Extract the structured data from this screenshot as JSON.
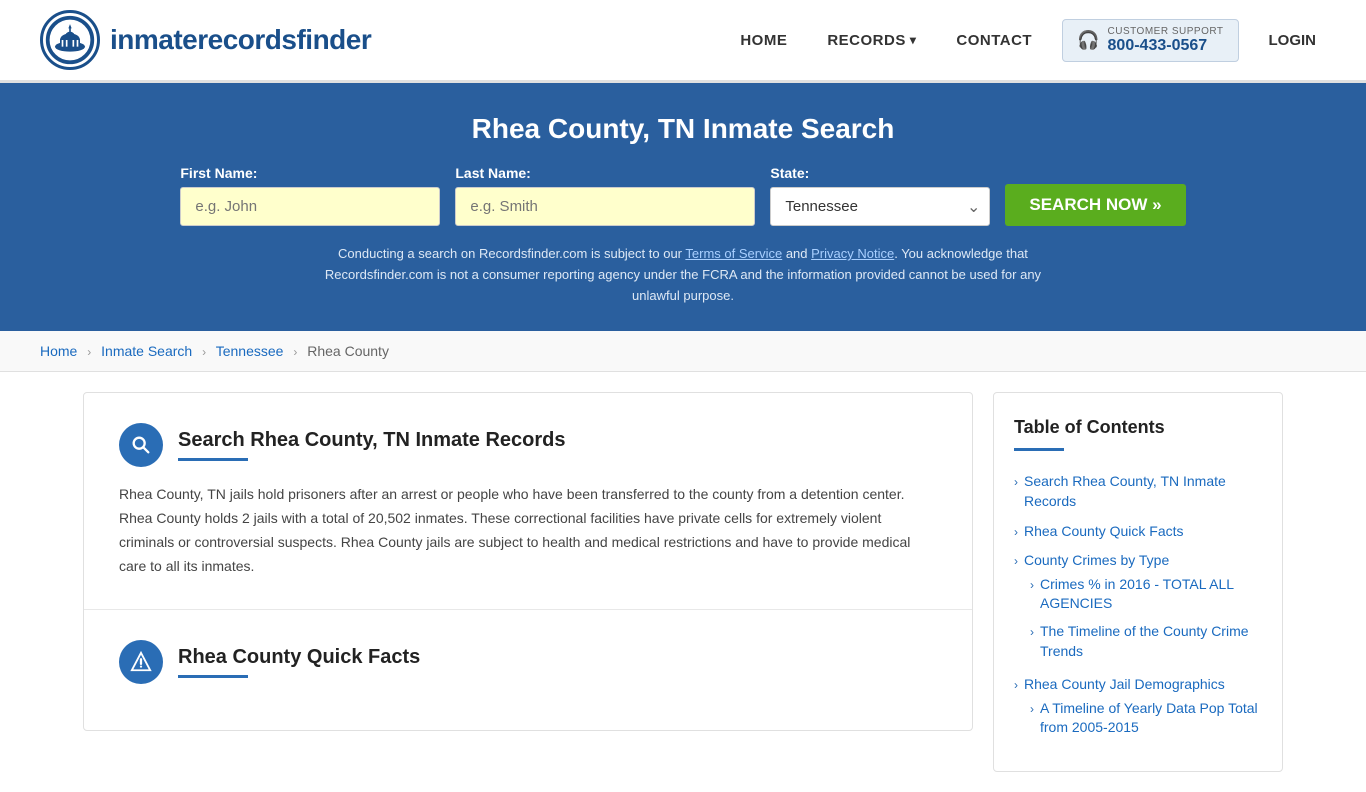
{
  "header": {
    "logo_text_regular": "inmaterecords",
    "logo_text_bold": "finder",
    "nav": {
      "home": "HOME",
      "records": "RECORDS",
      "contact": "CONTACT",
      "login": "LOGIN"
    },
    "support": {
      "label": "CUSTOMER SUPPORT",
      "number": "800-433-0567"
    }
  },
  "search_banner": {
    "title": "Rhea County, TN Inmate Search",
    "first_name_label": "First Name:",
    "first_name_placeholder": "e.g. John",
    "last_name_label": "Last Name:",
    "last_name_placeholder": "e.g. Smith",
    "state_label": "State:",
    "state_value": "Tennessee",
    "search_button": "SEARCH NOW »",
    "disclaimer": "Conducting a search on Recordsfinder.com is subject to our Terms of Service and Privacy Notice. You acknowledge that Recordsfinder.com is not a consumer reporting agency under the FCRA and the information provided cannot be used for any unlawful purpose.",
    "tos_link": "Terms of Service",
    "privacy_link": "Privacy Notice"
  },
  "breadcrumb": {
    "home": "Home",
    "inmate_search": "Inmate Search",
    "state": "Tennessee",
    "county": "Rhea County"
  },
  "main": {
    "section1": {
      "title": "Search Rhea County, TN Inmate Records",
      "body": "Rhea County, TN jails hold prisoners after an arrest or people who have been transferred to the county from a detention center. Rhea County holds 2 jails with a total of 20,502 inmates. These correctional facilities have private cells for extremely violent criminals or controversial suspects. Rhea County jails are subject to health and medical restrictions and have to provide medical care to all its inmates."
    },
    "section2": {
      "title": "Rhea County Quick Facts"
    }
  },
  "toc": {
    "title": "Table of Contents",
    "items": [
      {
        "label": "Search Rhea County, TN Inmate Records",
        "sub": false
      },
      {
        "label": "Rhea County Quick Facts",
        "sub": false
      },
      {
        "label": "County Crimes by Type",
        "sub": false
      },
      {
        "label": "Crimes % in 2016 - TOTAL ALL AGENCIES",
        "sub": true
      },
      {
        "label": "The Timeline of the County Crime Trends",
        "sub": true
      },
      {
        "label": "Rhea County Jail Demographics",
        "sub": false
      },
      {
        "label": "A Timeline of Yearly Data Pop Total from 2005-2015",
        "sub": true
      }
    ]
  }
}
